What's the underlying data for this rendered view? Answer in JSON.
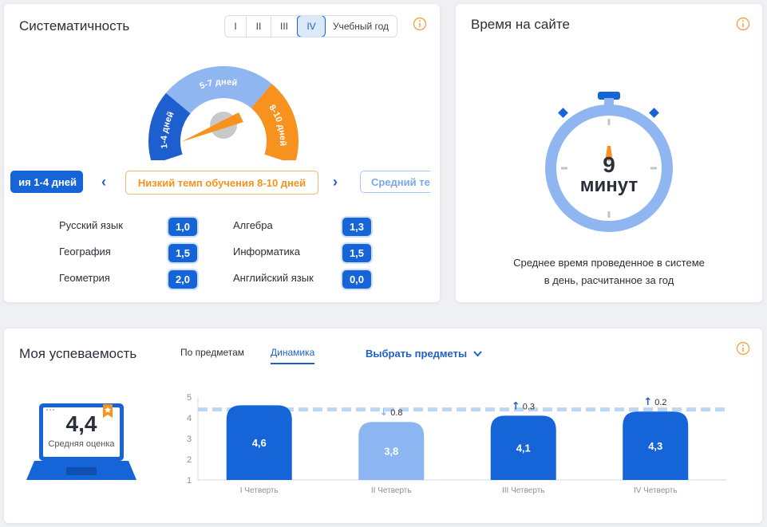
{
  "systematic": {
    "title": "Систематичность",
    "periods": [
      "I",
      "II",
      "III",
      "IV",
      "Учебный год"
    ],
    "active_period": "IV",
    "gauge": {
      "segments": [
        "1-4 дней",
        "5-7 дней",
        "8-10 дней"
      ],
      "colors": [
        "#1e5fd0",
        "#8fb6f1",
        "#f7921e"
      ]
    },
    "pace_pills": [
      "ия 1-4 дней",
      "Низкий темп обучения 8-10 дней",
      "Средний те"
    ],
    "subjects_left": [
      {
        "name": "Русский язык",
        "score": "1,0"
      },
      {
        "name": "География",
        "score": "1,5"
      },
      {
        "name": "Геометрия",
        "score": "2,0"
      }
    ],
    "subjects_right": [
      {
        "name": "Алгебра",
        "score": "1,3"
      },
      {
        "name": "Информатика",
        "score": "1,5"
      },
      {
        "name": "Английский язык",
        "score": "0,0"
      }
    ]
  },
  "time": {
    "title": "Время на сайте",
    "value": "9",
    "unit": "минут",
    "caption_line1": "Среднее время проведенное в системе",
    "caption_line2": "в день, расчитанное за год"
  },
  "performance": {
    "title": "Моя успеваемость",
    "tabs": [
      "По предметам",
      "Динамика"
    ],
    "active_tab": "Динамика",
    "select_subjects": "Выбрать предметы",
    "average": {
      "value": "4,4",
      "label": "Средняя оценка"
    },
    "chart_data": {
      "type": "bar",
      "categories": [
        "I Четверть",
        "II Четверть",
        "III Четверть",
        "IV Четверть"
      ],
      "values": [
        4.6,
        3.8,
        4.1,
        4.3
      ],
      "value_labels": [
        "4,6",
        "3,8",
        "4,1",
        "4,3"
      ],
      "deltas": [
        null,
        "0.8",
        "0.3",
        "0.2"
      ],
      "delta_directions": [
        null,
        "down",
        "up",
        "up"
      ],
      "y_ticks": [
        "1",
        "2",
        "3",
        "4",
        "5"
      ],
      "ylim": [
        1,
        5
      ],
      "average_line": 4.4,
      "bar_colors": [
        "#1565d8",
        "#8cb6f2",
        "#1565d8",
        "#1565d8"
      ]
    }
  },
  "colors": {
    "accent": "#1e5fc8",
    "orange": "#f7921e",
    "info": "#f5a34a"
  }
}
